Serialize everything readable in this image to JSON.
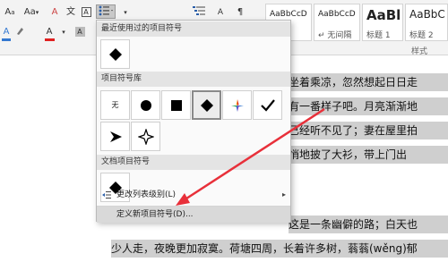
{
  "ribbon": {
    "font_size_shrink": "A",
    "font_size_sub": "a",
    "aa_case": "Aa",
    "clear_format": "A",
    "wen_char": "文",
    "bullet_list_icon": "bullet-list-icon",
    "sort_char": "A",
    "pinyin_char": "文",
    "font_color_char": "A",
    "highlight_char": "A"
  },
  "styles": {
    "cards": [
      {
        "preview": "AaBbCcD",
        "name": ""
      },
      {
        "preview": "AaBbCcD",
        "name": "↵ 无间隔"
      },
      {
        "preview": "AaBl",
        "name": "标题 1"
      },
      {
        "preview": "AaBbC",
        "name": "标题 2"
      }
    ],
    "group_label": "样式"
  },
  "document": {
    "lines": [
      {
        "text": "坐着乘凉，忽然想起日日走"
      },
      {
        "text": "有一番样子吧。月亮渐渐地"
      },
      {
        "text": "已经听不见了；妻在屋里拍"
      },
      {
        "text": "悄地披了大衫，带上门出"
      },
      {
        "text": "这是一条幽僻的路；白天也"
      },
      {
        "text": "少人走，夜晚更加寂寞。荷塘四周，长着许多树，蓊蓊(wěng)郁"
      }
    ]
  },
  "menu": {
    "recent_header": "最近使用过的项目符号",
    "library_header": "项目符号库",
    "document_header": "文档项目符号",
    "none_label": "无",
    "change_level": "更改列表级别(L)",
    "define_new": "定义新项目符号(D)..."
  },
  "colors": {
    "arrow": "#e8303a",
    "font_color_bar": "#e02020",
    "highlight_bar": "#3478d0"
  }
}
